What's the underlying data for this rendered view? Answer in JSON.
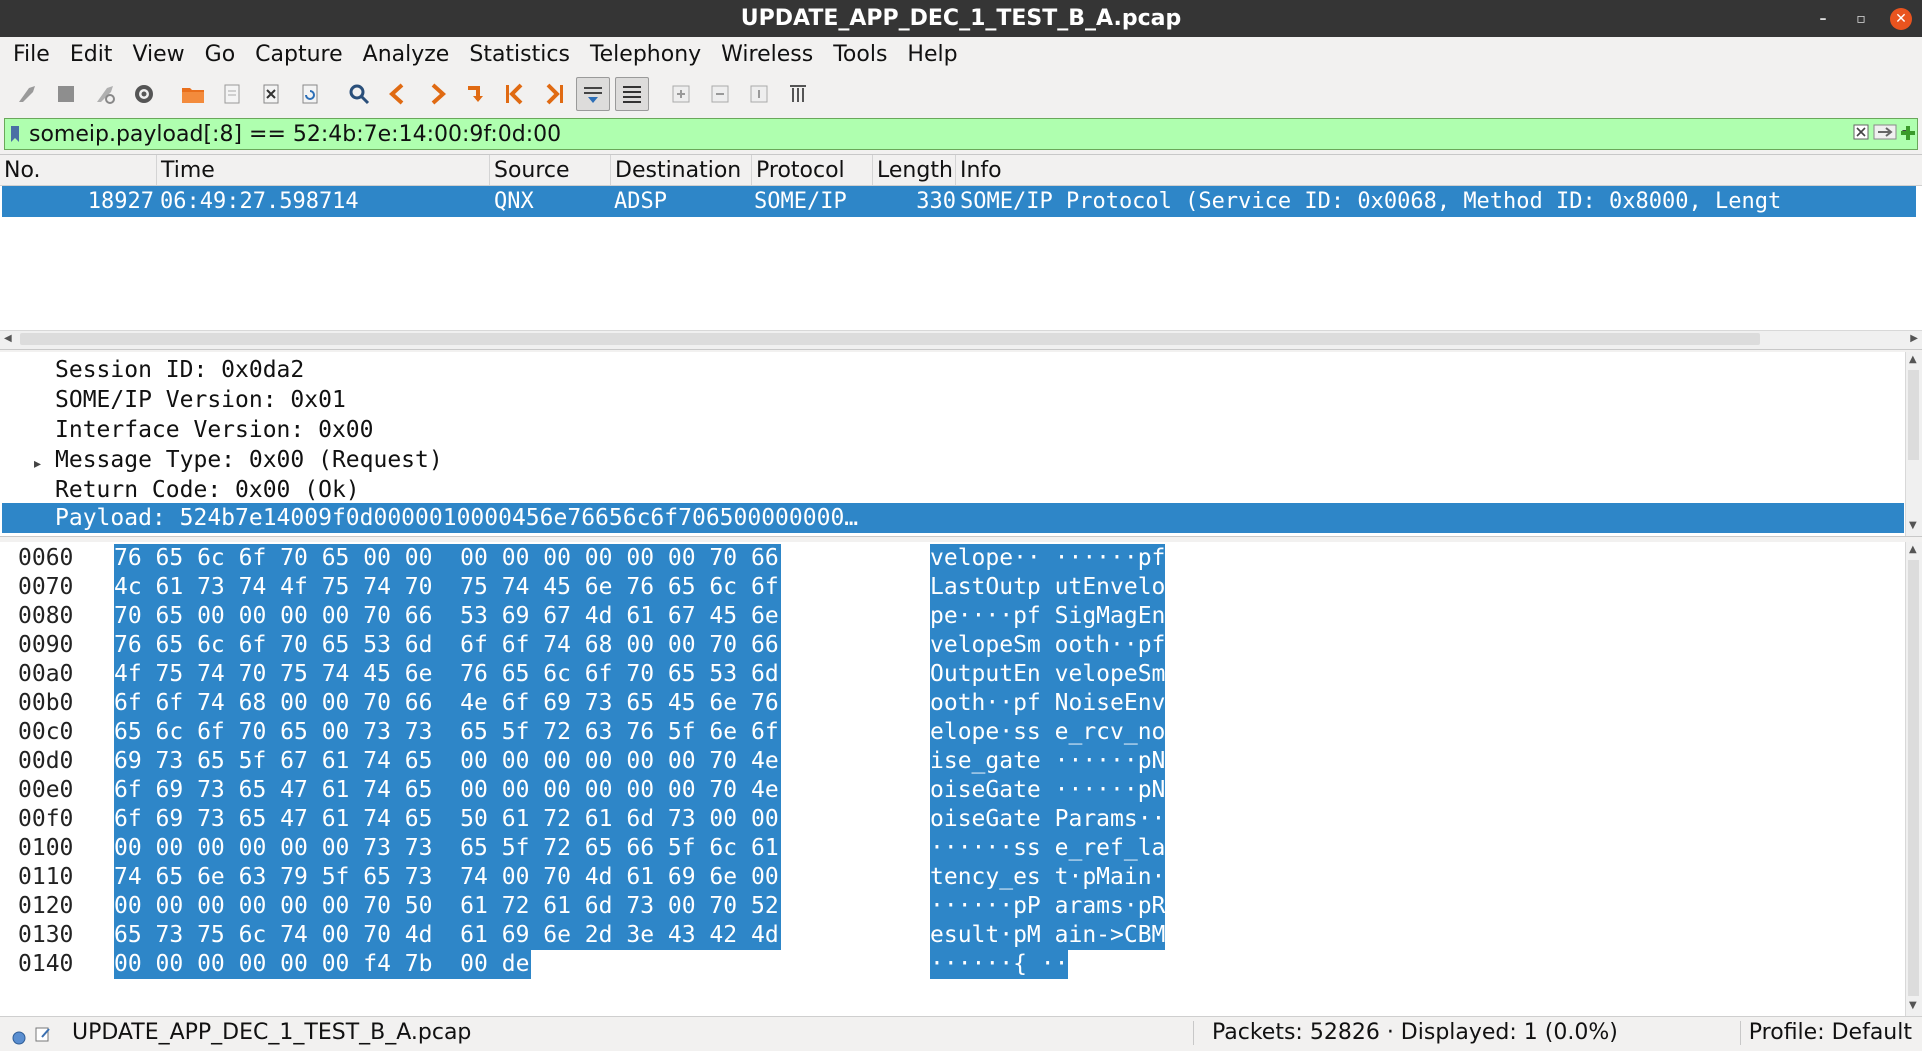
{
  "window": {
    "title": "UPDATE_APP_DEC_1_TEST_B_A.pcap"
  },
  "menu": {
    "file": "File",
    "edit": "Edit",
    "view": "View",
    "go": "Go",
    "capture": "Capture",
    "analyze": "Analyze",
    "statistics": "Statistics",
    "telephony": "Telephony",
    "wireless": "Wireless",
    "tools": "Tools",
    "help": "Help"
  },
  "filter": {
    "value": "someip.payload[:8] == 52:4b:7e:14:00:9f:0d:00"
  },
  "packet_list": {
    "columns": {
      "no": "No.",
      "time": "Time",
      "source": "Source",
      "destination": "Destination",
      "protocol": "Protocol",
      "length": "Length",
      "info": "Info"
    },
    "rows": [
      {
        "no": "18927",
        "time": "06:49:27.598714",
        "source": "QNX",
        "destination": "ADSP",
        "protocol": "SOME/IP",
        "length": "330",
        "info": "SOME/IP Protocol (Service ID: 0x0068, Method ID: 0x8000, Lengt"
      }
    ]
  },
  "details": {
    "lines": [
      "Session ID: 0x0da2",
      "SOME/IP Version: 0x01",
      "Interface Version: 0x00",
      "Message Type: 0x00 (Request)",
      "Return Code: 0x00 (Ok)",
      "Payload: 524b7e14009f0d0000010000456e76656c6f706500000000…"
    ]
  },
  "bytes": {
    "rows": [
      {
        "offset": "0060",
        "hex": "76 65 6c 6f 70 65 00 00  00 00 00 00 00 00 70 66",
        "ascii": "velope·· ······pf"
      },
      {
        "offset": "0070",
        "hex": "4c 61 73 74 4f 75 74 70  75 74 45 6e 76 65 6c 6f",
        "ascii": "LastOutp utEnvelo"
      },
      {
        "offset": "0080",
        "hex": "70 65 00 00 00 00 70 66  53 69 67 4d 61 67 45 6e",
        "ascii": "pe····pf SigMagEn"
      },
      {
        "offset": "0090",
        "hex": "76 65 6c 6f 70 65 53 6d  6f 6f 74 68 00 00 70 66",
        "ascii": "velopeSm ooth··pf"
      },
      {
        "offset": "00a0",
        "hex": "4f 75 74 70 75 74 45 6e  76 65 6c 6f 70 65 53 6d",
        "ascii": "OutputEn velopeSm"
      },
      {
        "offset": "00b0",
        "hex": "6f 6f 74 68 00 00 70 66  4e 6f 69 73 65 45 6e 76",
        "ascii": "ooth··pf NoiseEnv"
      },
      {
        "offset": "00c0",
        "hex": "65 6c 6f 70 65 00 73 73  65 5f 72 63 76 5f 6e 6f",
        "ascii": "elope·ss e_rcv_no"
      },
      {
        "offset": "00d0",
        "hex": "69 73 65 5f 67 61 74 65  00 00 00 00 00 00 70 4e",
        "ascii": "ise_gate ······pN"
      },
      {
        "offset": "00e0",
        "hex": "6f 69 73 65 47 61 74 65  00 00 00 00 00 00 70 4e",
        "ascii": "oiseGate ······pN"
      },
      {
        "offset": "00f0",
        "hex": "6f 69 73 65 47 61 74 65  50 61 72 61 6d 73 00 00",
        "ascii": "oiseGate Params··"
      },
      {
        "offset": "0100",
        "hex": "00 00 00 00 00 00 73 73  65 5f 72 65 66 5f 6c 61",
        "ascii": "······ss e_ref_la"
      },
      {
        "offset": "0110",
        "hex": "74 65 6e 63 79 5f 65 73  74 00 70 4d 61 69 6e 00",
        "ascii": "tency_es t·pMain·"
      },
      {
        "offset": "0120",
        "hex": "00 00 00 00 00 00 70 50  61 72 61 6d 73 00 70 52",
        "ascii": "······pP arams·pR"
      },
      {
        "offset": "0130",
        "hex": "65 73 75 6c 74 00 70 4d  61 69 6e 2d 3e 43 42 4d",
        "ascii": "esult·pM ain->CBM"
      },
      {
        "offset": "0140",
        "hex": "00 00 00 00 00 00 f4 7b  00 de",
        "ascii": "······{ ··"
      }
    ]
  },
  "status": {
    "file": "UPDATE_APP_DEC_1_TEST_B_A.pcap",
    "packets": "Packets: 52826 · Displayed: 1 (0.0%)",
    "profile": "Profile: Default"
  },
  "colors": {
    "selection": "#2e86c8",
    "filter_ok": "#afffaf",
    "titlebar": "#353535"
  }
}
